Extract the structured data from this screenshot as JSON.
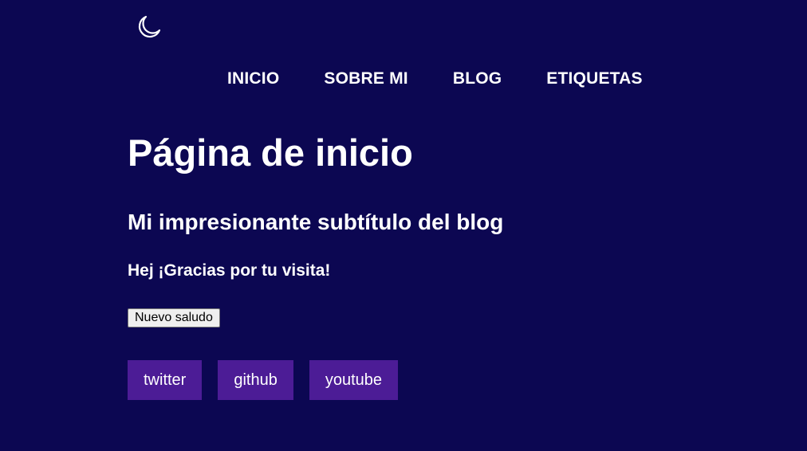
{
  "theme_toggle": {
    "icon": "moon-icon"
  },
  "nav": {
    "items": [
      {
        "label": "INICIO"
      },
      {
        "label": "SOBRE MI"
      },
      {
        "label": "BLOG"
      },
      {
        "label": "ETIQUETAS"
      }
    ]
  },
  "main": {
    "title": "Página de inicio",
    "subtitle": "Mi impresionante subtítulo del blog",
    "greeting": "Hej ¡Gracias por tu visita!",
    "greet_button_label": "Nuevo saludo"
  },
  "social": {
    "links": [
      {
        "label": "twitter"
      },
      {
        "label": "github"
      },
      {
        "label": "youtube"
      }
    ]
  },
  "colors": {
    "background": "#0c0752",
    "text": "#ffffff",
    "social_button": "#4c1c96"
  }
}
